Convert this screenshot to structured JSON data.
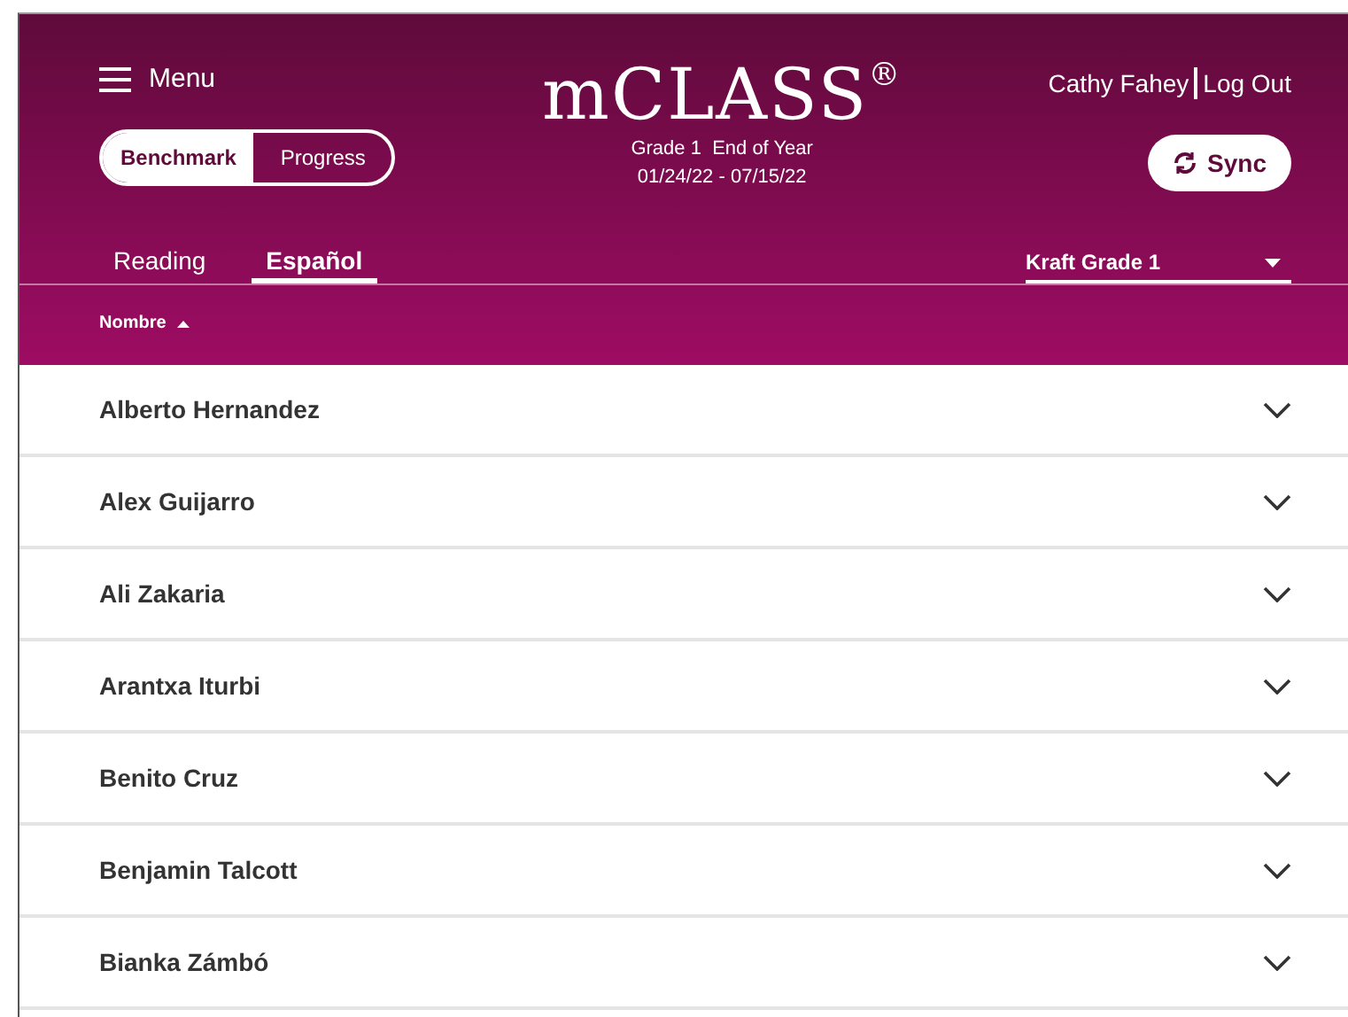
{
  "header": {
    "menu_label": "Menu",
    "logo": "mCLASS",
    "logo_mark": "®",
    "grade": "Grade 1",
    "period": "End of Year",
    "dates": "01/24/22 - 07/15/22",
    "user": "Cathy Fahey",
    "logout": "Log Out",
    "sync": "Sync"
  },
  "modes": [
    {
      "label": "Benchmark",
      "selected": true
    },
    {
      "label": "Progress",
      "selected": false
    }
  ],
  "tabs": [
    {
      "label": "Reading",
      "selected": false
    },
    {
      "label": "Español",
      "selected": true
    }
  ],
  "class_select": {
    "value": "Kraft Grade 1"
  },
  "sort_column": {
    "label": "Nombre"
  },
  "students": [
    {
      "name": "Alberto Hernandez",
      "expanded": false
    },
    {
      "name": "Alex Guijarro",
      "expanded": false
    },
    {
      "name": "Ali Zakaria",
      "expanded": false
    },
    {
      "name": "Arantxa Iturbi",
      "expanded": false
    },
    {
      "name": "Benito Cruz",
      "expanded": false
    },
    {
      "name": "Benjamin Talcott",
      "expanded": false
    },
    {
      "name": "Bianka Zámbó",
      "expanded": false
    }
  ]
}
